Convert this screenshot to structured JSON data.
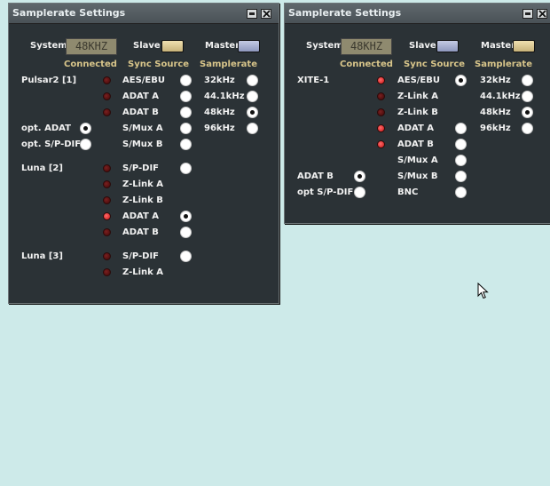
{
  "colors": {
    "desktop": "#cdeae9",
    "window_bg": "#2b3236",
    "header_text": "#d8c58a",
    "led_on": "#e02020",
    "led_off": "#5a1010",
    "slave_active": "#d8c590",
    "master_active": "#d8c590",
    "inactive_button": "#9aa4c8"
  },
  "win1": {
    "title": "Samplerate Settings",
    "system_label": "System",
    "lcd_value": "48KHZ",
    "slave_label": "Slave",
    "master_label": "Master",
    "slave_state": "active",
    "master_state": "inactive",
    "headers": {
      "connected": "Connected",
      "sync_source": "Sync Source",
      "samplerate": "Samplerate"
    },
    "devices": {
      "pulsar": "Pulsar2 [1]",
      "luna2": "Luna [2]",
      "luna3": "Luna [3]"
    },
    "options": {
      "opt_adat": "opt. ADAT",
      "opt_spdif": "opt. S/P-DIF"
    },
    "sync": {
      "aes_ebu": "AES/EBU",
      "adat_a_1": "ADAT A",
      "adat_b_1": "ADAT B",
      "smux_a": "S/Mux A",
      "smux_b": "S/Mux B",
      "spdif_2": "S/P-DIF",
      "zlink_a_2": "Z-Link A",
      "zlink_b_2": "Z-Link B",
      "adat_a_2": "ADAT A",
      "adat_b_2": "ADAT B",
      "spdif_3": "S/P-DIF",
      "zlink_a_3": "Z-Link A"
    },
    "rates": {
      "r32": "32kHz",
      "r44": "44.1kHz",
      "r48": "48kHz",
      "r96": "96kHz"
    },
    "selected_rate": "48kHz",
    "selected_sync": "ADAT A (Luna [2])"
  },
  "win2": {
    "title": "Samplerate Settings",
    "system_label": "System",
    "lcd_value": "48KHZ",
    "slave_label": "Slave",
    "master_label": "Master",
    "slave_state": "inactive",
    "master_state": "active",
    "headers": {
      "connected": "Connected",
      "sync_source": "Sync Source",
      "samplerate": "Samplerate"
    },
    "devices": {
      "xite": "XITE-1"
    },
    "options": {
      "adat_b": "ADAT B",
      "opt_spdif": "opt S/P-DIF"
    },
    "sync": {
      "aes_ebu": "AES/EBU",
      "zlink_a": "Z-Link A",
      "zlink_b": "Z-Link B",
      "adat_a": "ADAT A",
      "adat_b": "ADAT B",
      "smux_a": "S/Mux A",
      "smux_b": "S/Mux B",
      "bnc": "BNC"
    },
    "rates": {
      "r32": "32kHz",
      "r44": "44.1kHz",
      "r48": "48kHz",
      "r96": "96kHz"
    },
    "selected_rate": "48kHz",
    "selected_sync": "AES/EBU"
  }
}
